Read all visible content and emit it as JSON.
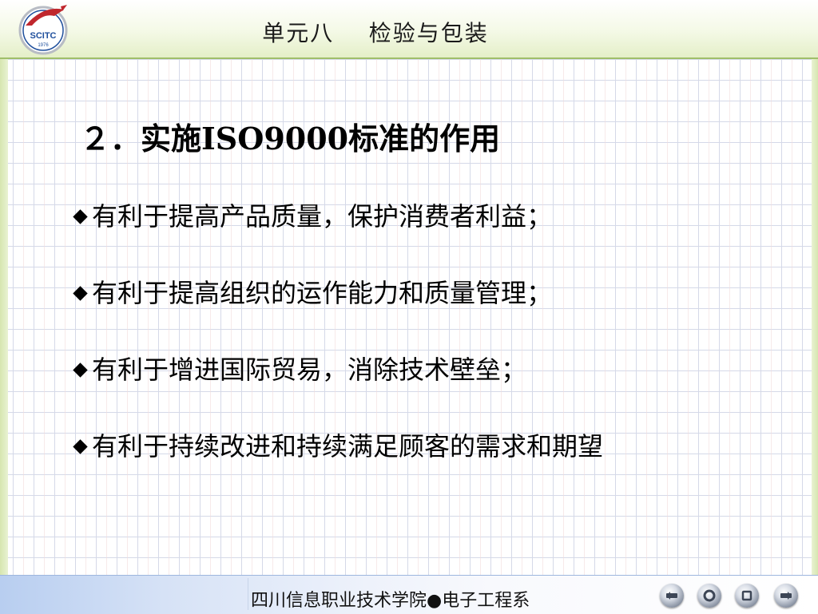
{
  "header": {
    "title": "单元八    检验与包装",
    "logo_text": "SCITC",
    "logo_year": "1976"
  },
  "content": {
    "heading": "２．实施ISO9000标准的作用",
    "bullets": [
      "有利于提高产品质量，保护消费者利益；",
      "有利于提高组织的运作能力和质量管理；",
      "有利于增进国际贸易，消除技术壁垒；",
      "有利于持续改进和持续满足顾客的需求和期望"
    ]
  },
  "footer": {
    "text": "四川信息职业技术学院●电子工程系",
    "nav_buttons": [
      "prev-icon",
      "home-icon",
      "stop-icon",
      "next-icon"
    ]
  },
  "colors": {
    "header_border": "#9fbf6a",
    "grid_line": "#d5d9e8",
    "logo_red": "#c0272d",
    "logo_blue": "#1f4f9c"
  }
}
